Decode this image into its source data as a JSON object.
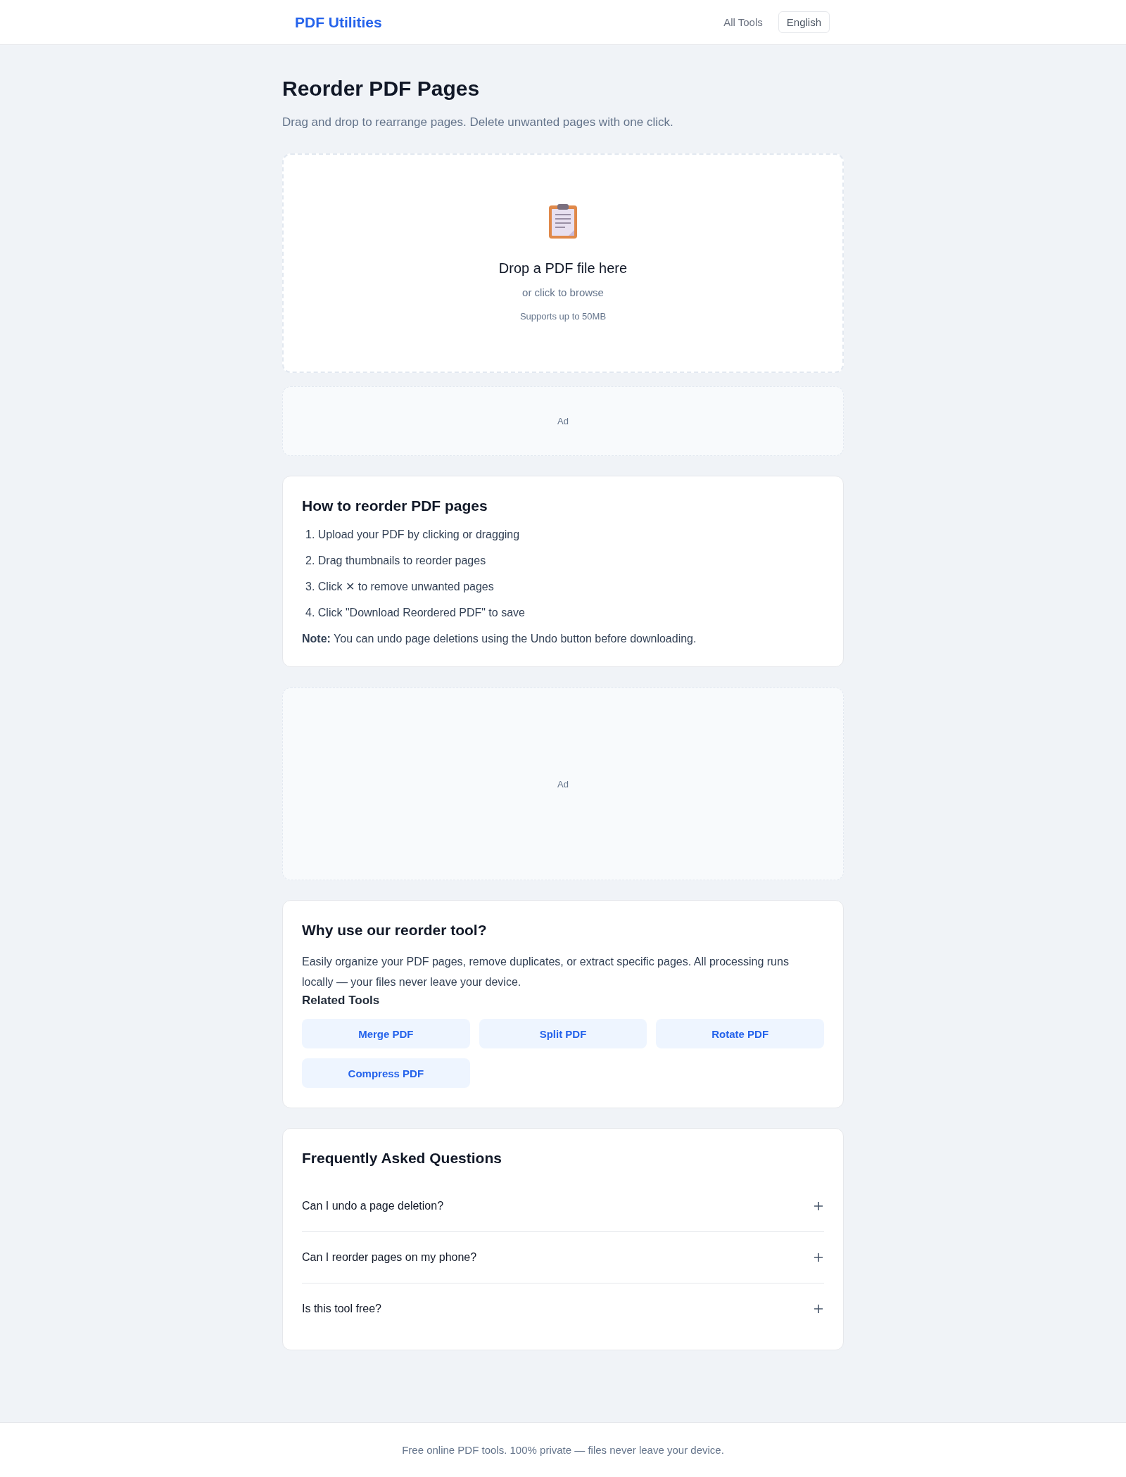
{
  "header": {
    "logo": "PDF Utilities",
    "nav_link": "All Tools",
    "language_button": "English"
  },
  "page": {
    "title": "Reorder PDF Pages",
    "subtitle": "Drag and drop to rearrange pages. Delete unwanted pages with one click."
  },
  "upload": {
    "title": "Drop a PDF file here",
    "hint": "or click to browse",
    "limit": "Supports up to 50MB"
  },
  "ads": [
    {
      "label": "Ad",
      "kind": "banner"
    },
    {
      "label": "Ad",
      "kind": "block"
    }
  ],
  "how_to": {
    "title": "How to reorder PDF pages",
    "steps": [
      {
        "number": "1.",
        "text": "Upload your PDF by clicking or dragging"
      },
      {
        "number": "2.",
        "text": "Drag thumbnails to reorder pages"
      },
      {
        "number": "3.",
        "text": "Click ✕ to remove unwanted pages"
      },
      {
        "number": "4.",
        "text": "Click \"Download Reordered PDF\" to save"
      }
    ],
    "note": "**Note:** You can undo page deletions using the Undo button before downloading."
  },
  "why": {
    "title": "Why use our reorder tool?",
    "text": "Easily organize your PDF pages, remove duplicates, or extract specific pages. All processing runs locally — your files never leave your device.",
    "related_title": "Related Tools",
    "related_tools": [
      "Merge PDF",
      "Split PDF",
      "Rotate PDF",
      "Compress PDF"
    ]
  },
  "faq": {
    "title": "Frequently Asked Questions",
    "items": [
      {
        "question": "Can I undo a page deletion?",
        "expanded": false
      },
      {
        "question": "Can I reorder pages on my phone?",
        "expanded": false
      },
      {
        "question": "Is this tool free?",
        "expanded": false
      }
    ]
  },
  "footer": {
    "text": "Free online PDF tools. 100% private — files never leave your device."
  }
}
